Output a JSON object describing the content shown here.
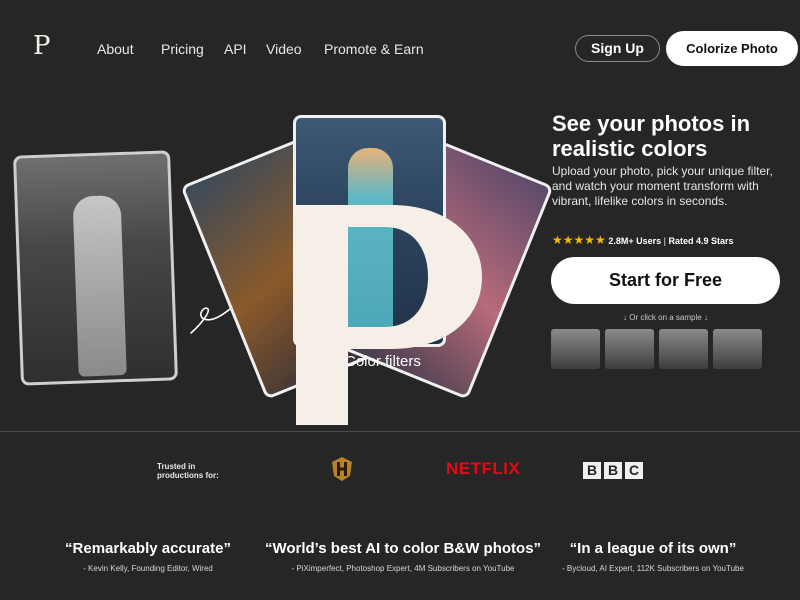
{
  "nav": {
    "logo": "P",
    "links": [
      "About",
      "Pricing",
      "API",
      "Video",
      "Promote & Earn"
    ],
    "signup_label": "Sign Up",
    "colorize_label": "Colorize Photo"
  },
  "hero": {
    "filters_label": "Color filters",
    "headline": "See your photos in realistic colors",
    "subtext": "Upload your photo, pick your unique filter, and watch your moment transform with vibrant, lifelike colors in seconds.",
    "stars": "★★★★★",
    "users": "2.8M+ Users",
    "separator": "|",
    "rating": "Rated 4.9 Stars",
    "cta_label": "Start for Free",
    "sample_hint": "↓ Or click on a sample ↓"
  },
  "trusted": {
    "label": "Trusted in productions for:",
    "netflix": "NETFLIX",
    "bbc": [
      "B",
      "B",
      "C"
    ]
  },
  "quotes": [
    {
      "text": "“Remarkably accurate”",
      "author": "- Kevin Kelly, Founding Editor, Wired"
    },
    {
      "text": "“World’s best AI to color B&W photos”",
      "author": "- PiXimperfect, Photoshop Expert, 4M Subscribers on YouTube"
    },
    {
      "text": "“In a league of its own”",
      "author": "- Bycloud, AI Expert, 112K Subscribers on YouTube"
    }
  ],
  "colors": {
    "background": "#262626",
    "accent_star": "#f5b800",
    "netflix_red": "#e50914",
    "logo_cream": "#f5efe8"
  }
}
